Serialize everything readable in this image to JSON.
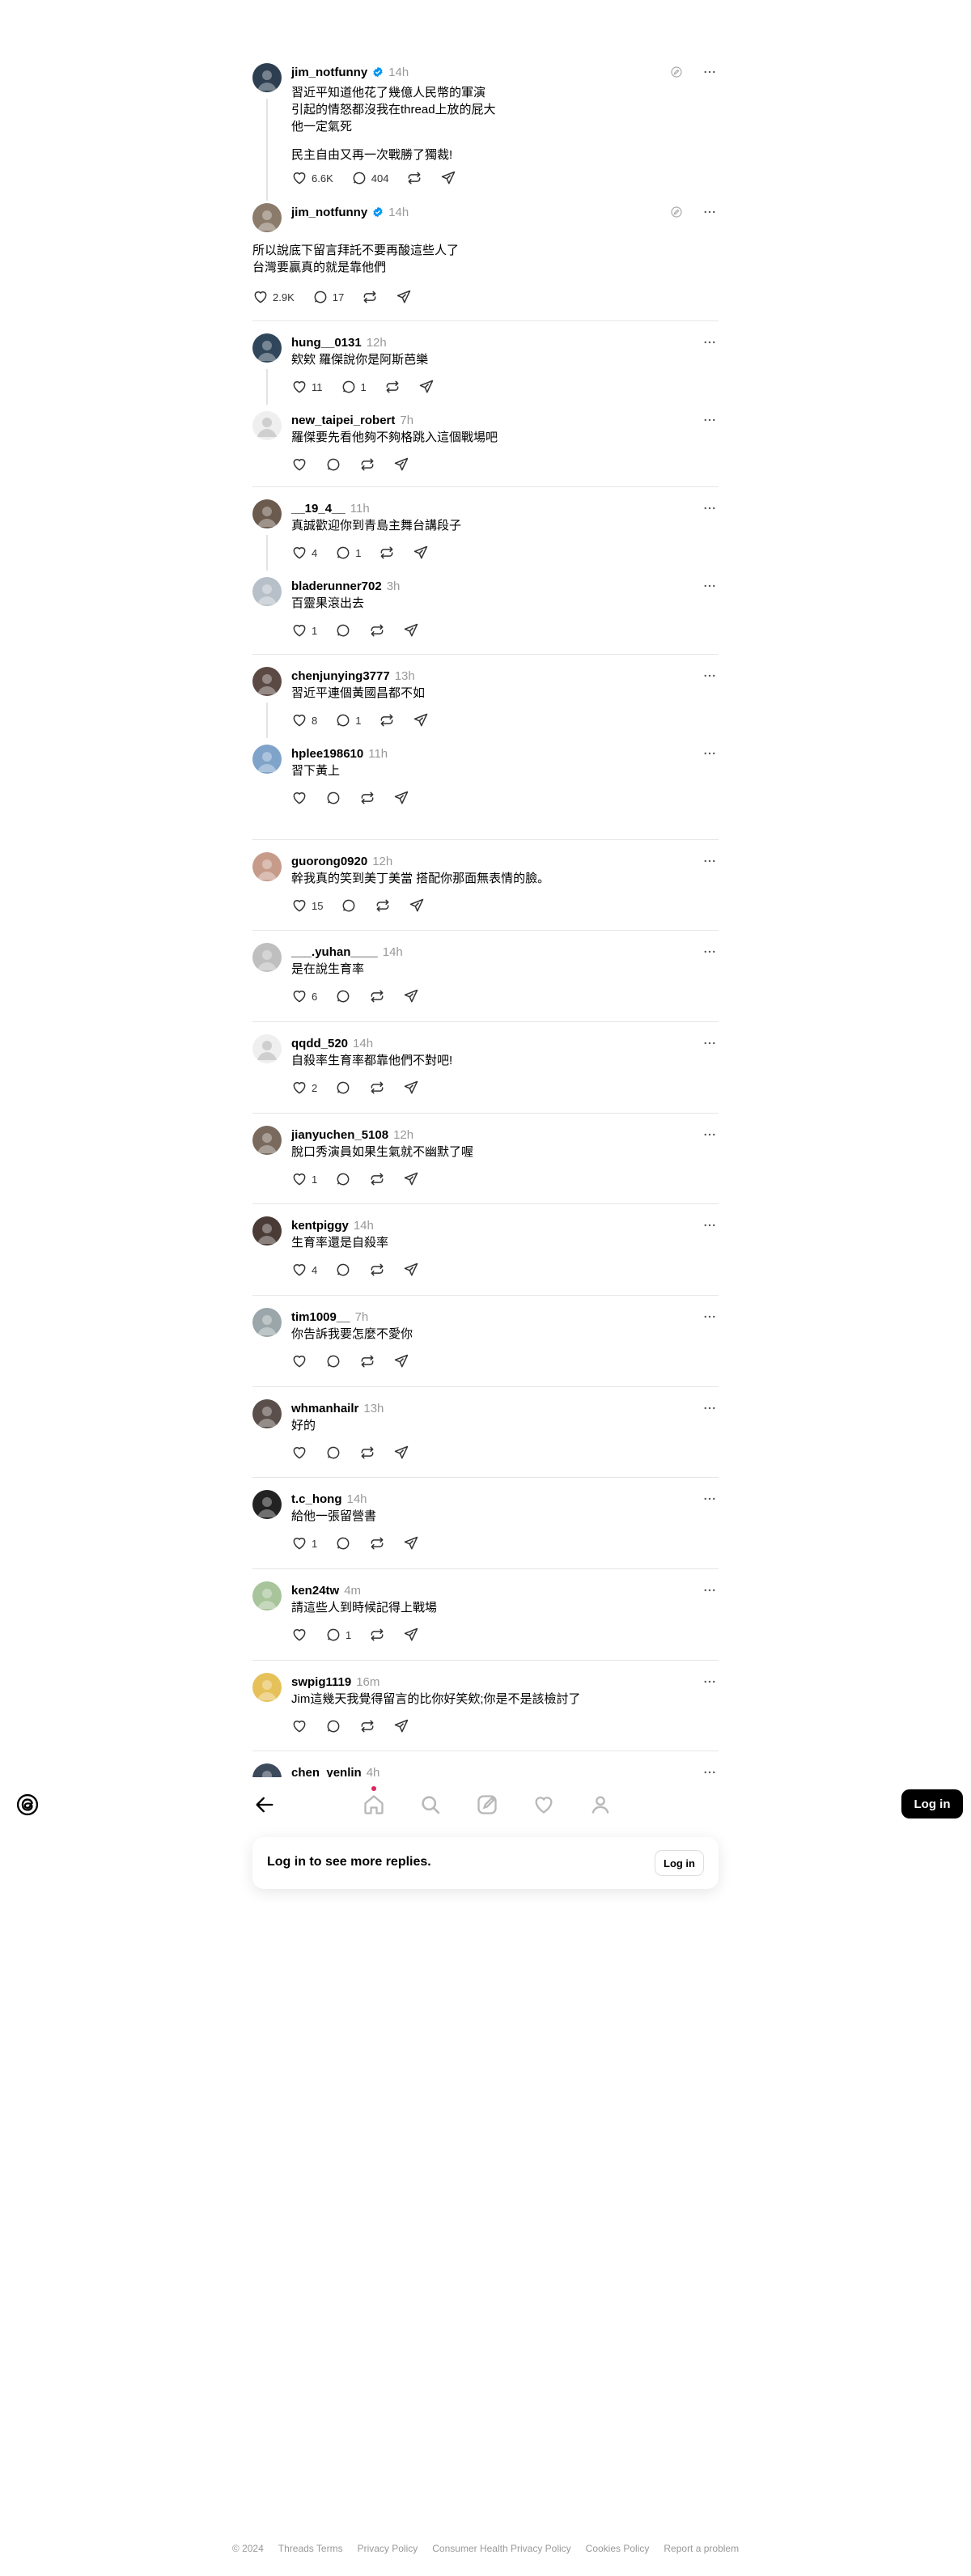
{
  "colors": {
    "accent": "#000000",
    "verified": "#0095f6",
    "notification_dot": "#e0245e",
    "muted": "#999999",
    "divider": "#e6e6e6"
  },
  "op_posts": [
    {
      "username": "jim_notfunny",
      "time": "14h",
      "verified": true,
      "lines": [
        "習近平知道他花了幾億人民幣的軍演",
        "引起的情怒都沒我在thread上放的屁大",
        "他一定氣死",
        "",
        "民主自由又再一次戰勝了獨裁!"
      ],
      "likes": "6.6K",
      "replies": "404"
    },
    {
      "username": "jim_notfunny",
      "time": "14h",
      "verified": true,
      "lines": [
        "所以說底下留言拜託不要再酸這些人了",
        "台灣要贏真的就是靠他們"
      ],
      "likes": "2.9K",
      "replies": "17"
    }
  ],
  "threads": [
    [
      {
        "username": "hung__0131",
        "time": "12h",
        "text": "欸欸 羅傑說你是阿斯芭樂",
        "likes": "11",
        "replies": "1",
        "avatar": "photo"
      },
      {
        "username": "new_taipei_robert",
        "time": "7h",
        "text": "羅傑要先看他夠不夠格跳入這個戰場吧",
        "likes": "",
        "replies": "",
        "avatar": "blank"
      }
    ],
    [
      {
        "username": "__19_4__",
        "time": "11h",
        "text": "真誠歡迎你到青島主舞台講段子",
        "likes": "4",
        "replies": "1",
        "avatar": "photo"
      },
      {
        "username": "bladerunner702",
        "time": "3h",
        "text": "百靈果滾出去",
        "likes": "1",
        "replies": "",
        "avatar": "photo"
      }
    ],
    [
      {
        "username": "chenjunying3777",
        "time": "13h",
        "text": "習近平連個黃國昌都不如",
        "likes": "8",
        "replies": "1",
        "avatar": "photo"
      },
      {
        "username": "hplee198610",
        "time": "11h",
        "text": "習下黃上",
        "likes": "",
        "replies": "",
        "avatar": "photo"
      }
    ],
    [
      {
        "username": "guorong0920",
        "time": "12h",
        "text": "幹我真的笑到美丁美當 搭配你那面無表情的臉。",
        "likes": "15",
        "replies": "",
        "avatar": "photo"
      }
    ],
    [
      {
        "username": "___.yuhan____",
        "time": "14h",
        "text": "是在說生育率",
        "likes": "6",
        "replies": "",
        "avatar": "photo"
      }
    ],
    [
      {
        "username": "qqdd_520",
        "time": "14h",
        "text": "自殺率生育率都靠他們不對吧!",
        "likes": "2",
        "replies": "",
        "avatar": "blank"
      }
    ],
    [
      {
        "username": "jianyuchen_5108",
        "time": "12h",
        "text": "脫口秀演員如果生氣就不幽默了喔",
        "likes": "1",
        "replies": "",
        "avatar": "photo"
      }
    ],
    [
      {
        "username": "kentpiggy",
        "time": "14h",
        "text": "生育率還是自殺率",
        "likes": "4",
        "replies": "",
        "avatar": "photo"
      }
    ],
    [
      {
        "username": "tim1009__",
        "time": "7h",
        "text": "你告訴我要怎麼不愛你",
        "likes": "",
        "replies": "",
        "avatar": "photo"
      }
    ],
    [
      {
        "username": "whmanhailr",
        "time": "13h",
        "text": "好的",
        "likes": "",
        "replies": "",
        "avatar": "photo"
      }
    ],
    [
      {
        "username": "t.c_hong",
        "time": "14h",
        "text": "給他一張留營書",
        "likes": "1",
        "replies": "",
        "avatar": "photo"
      }
    ],
    [
      {
        "username": "ken24tw",
        "time": "4m",
        "text": "請這些人到時候記得上戰場",
        "likes": "",
        "replies": "1",
        "avatar": "photo"
      }
    ],
    [
      {
        "username": "swpig1119",
        "time": "16m",
        "text": "Jim這幾天我覺得留言的比你好笑欸;你是不是該檢討了",
        "likes": "",
        "replies": "",
        "avatar": "photo"
      }
    ],
    [
      {
        "username": "chen_yenlin",
        "time": "4h",
        "text": "",
        "likes": "",
        "replies": "",
        "avatar": "photo"
      }
    ]
  ],
  "more_replies": {
    "text": "Log in to see more replies.",
    "button": "Log in"
  },
  "nav": {
    "login_button": "Log in",
    "icons": [
      "back-icon",
      "home-icon",
      "search-icon",
      "create-icon",
      "heart-icon",
      "profile-icon"
    ]
  },
  "footer": [
    "© 2024",
    "Threads Terms",
    "Privacy Policy",
    "Consumer Health Privacy Policy",
    "Cookies Policy",
    "Report a problem"
  ]
}
